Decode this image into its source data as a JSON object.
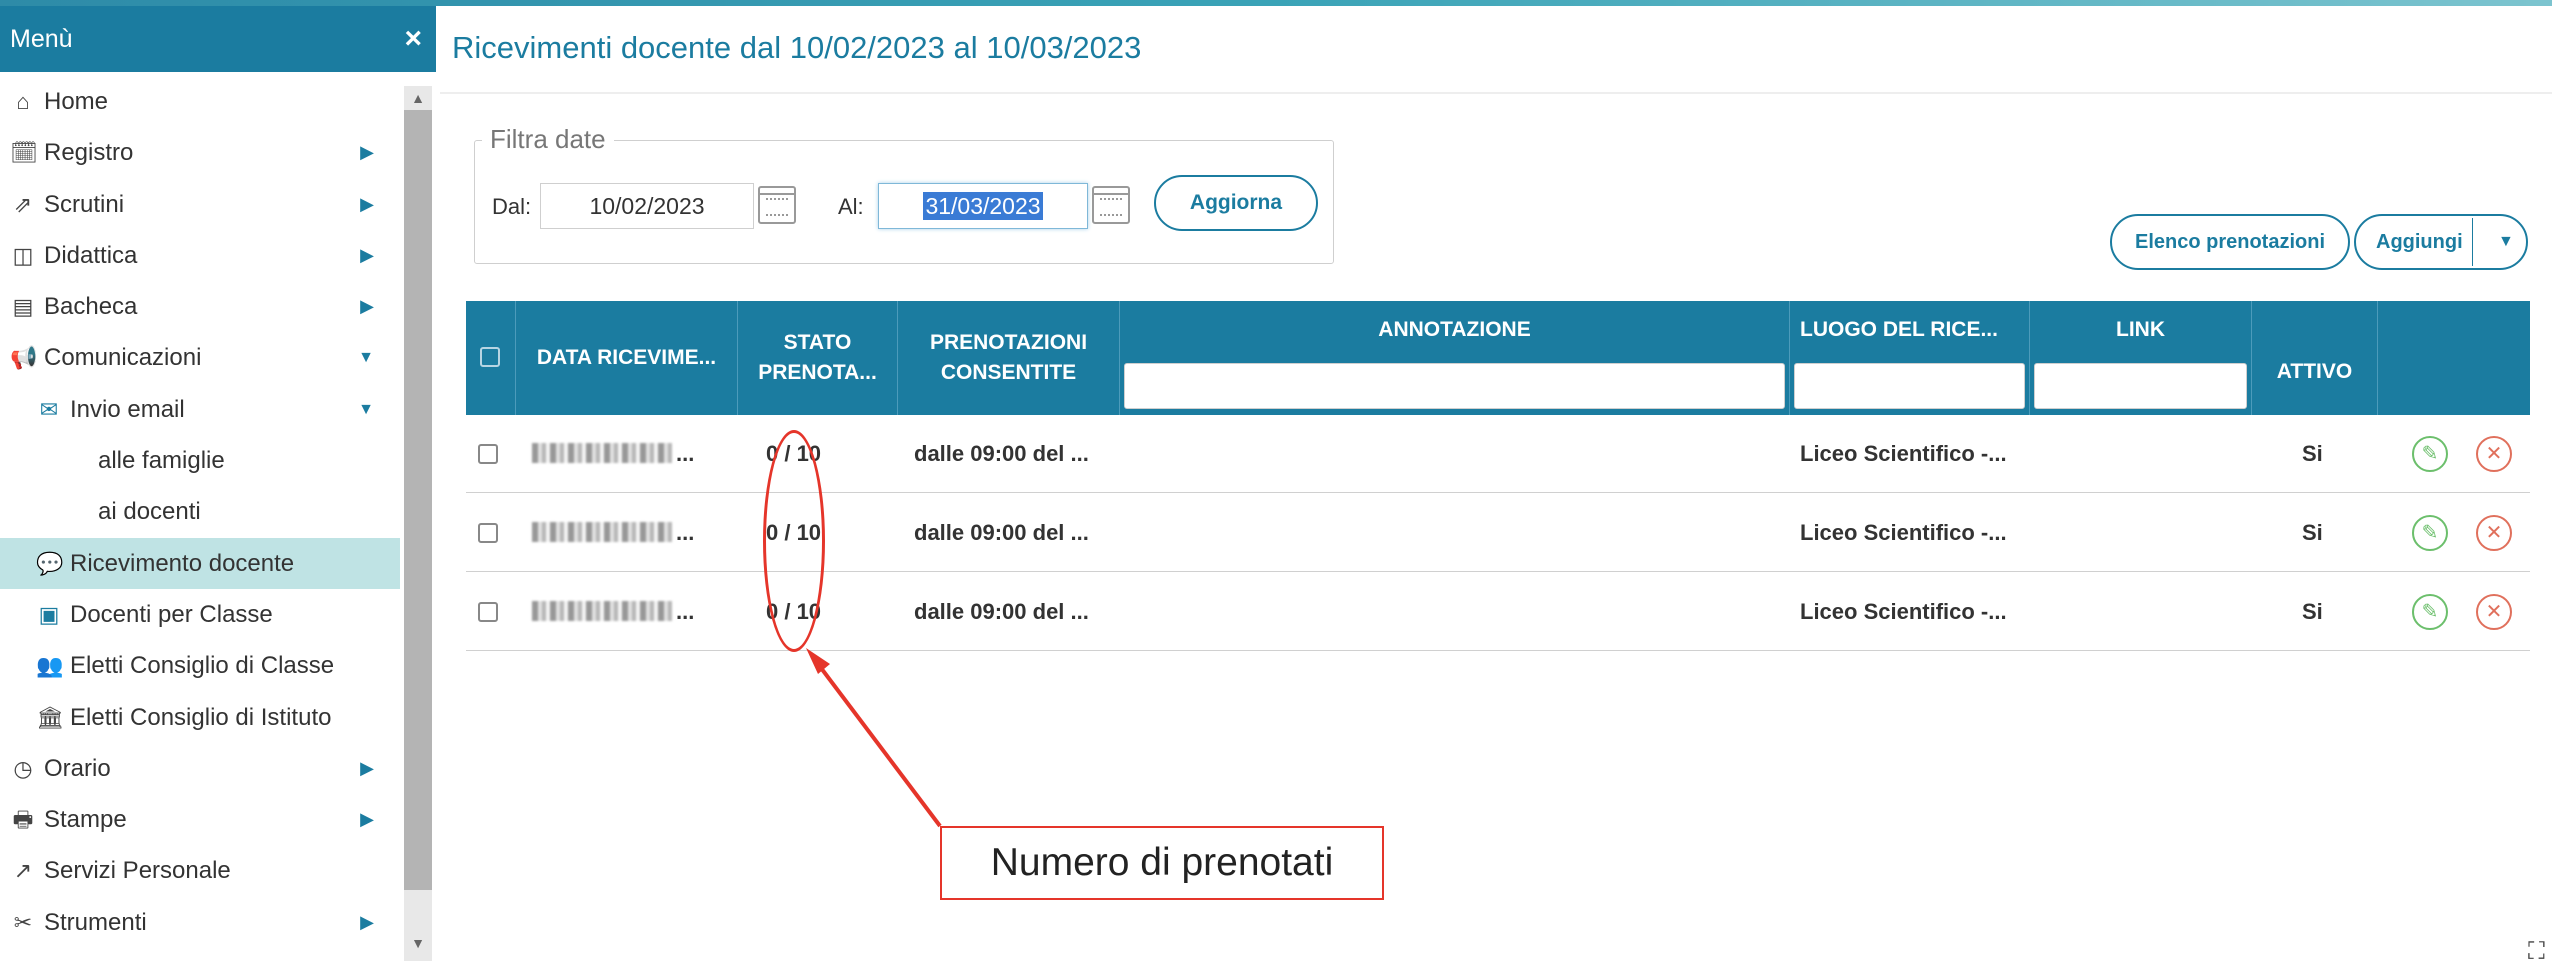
{
  "sidebar": {
    "header": "Menù",
    "close_icon": "×",
    "items": [
      {
        "label": "Home",
        "icon": "home-icon",
        "glyph": "⌂"
      },
      {
        "label": "Registro",
        "icon": "calendar-check-icon",
        "glyph": "🗓"
      },
      {
        "label": "Scrutini",
        "icon": "export-icon",
        "glyph": "⇗"
      },
      {
        "label": "Didattica",
        "icon": "book-icon",
        "glyph": "◫"
      },
      {
        "label": "Bacheca",
        "icon": "newspaper-icon",
        "glyph": "▤"
      },
      {
        "label": "Comunicazioni",
        "icon": "bullhorn-icon",
        "glyph": "📢"
      },
      {
        "label": "Invio email",
        "icon": "envelope-icon",
        "glyph": "✉"
      },
      {
        "label": "alle famiglie"
      },
      {
        "label": "ai docenti"
      },
      {
        "label": "Ricevimento docente",
        "icon": "comments-icon",
        "glyph": "💬"
      },
      {
        "label": "Docenti per Classe",
        "icon": "users-card-icon",
        "glyph": "▣"
      },
      {
        "label": "Eletti Consiglio di Classe",
        "icon": "group-icon",
        "glyph": "👥"
      },
      {
        "label": "Eletti Consiglio di Istituto",
        "icon": "institution-icon",
        "glyph": "🏛"
      },
      {
        "label": "Orario",
        "icon": "clock-icon",
        "glyph": "◷"
      },
      {
        "label": "Stampe",
        "icon": "print-icon",
        "glyph": "🖶"
      },
      {
        "label": "Servizi Personale",
        "icon": "share-icon",
        "glyph": "↗"
      },
      {
        "label": "Strumenti",
        "icon": "tools-icon",
        "glyph": "✂"
      }
    ]
  },
  "page": {
    "title": "Ricevimenti docente dal 10/02/2023 al 10/03/2023"
  },
  "filter": {
    "legend": "Filtra date",
    "from_label": "Dal:",
    "from_value": "10/02/2023",
    "to_label": "Al:",
    "to_value": "31/03/2023",
    "refresh_button": "Aggiorna"
  },
  "actions": {
    "list_bookings_button": "Elenco prenotazioni",
    "add_button": "Aggiungi"
  },
  "table": {
    "columns": {
      "date": "DATA RICEVIME...",
      "status_line1": "STATO",
      "status_line2": "PRENOTA...",
      "allowed_line1": "PRENOTAZIONI",
      "allowed_line2": "CONSENTITE",
      "note": "ANNOTAZIONE",
      "place": "LUOGO DEL RICE...",
      "link": "LINK",
      "active": "ATTIVO"
    },
    "rows": [
      {
        "date_suffix": "...",
        "status": "0 / 10",
        "allowed": "dalle 09:00 del ...",
        "note": "",
        "place": "Liceo Scientifico -...",
        "link": "",
        "active": "Si"
      },
      {
        "date_suffix": "...",
        "status": "0 / 10",
        "allowed": "dalle 09:00 del ...",
        "note": "",
        "place": "Liceo Scientifico -...",
        "link": "",
        "active": "Si"
      },
      {
        "date_suffix": "...",
        "status": "0 / 10",
        "allowed": "dalle 09:00 del ...",
        "note": "",
        "place": "Liceo Scientifico -...",
        "link": "",
        "active": "Si"
      }
    ]
  },
  "annotation": {
    "callout_text": "Numero di prenotati",
    "color": "#e5352a"
  },
  "colors": {
    "accent": "#1b7ca0",
    "active_menu": "#bfe3e4",
    "edit": "#6cbf6c",
    "delete": "#e0705c"
  }
}
